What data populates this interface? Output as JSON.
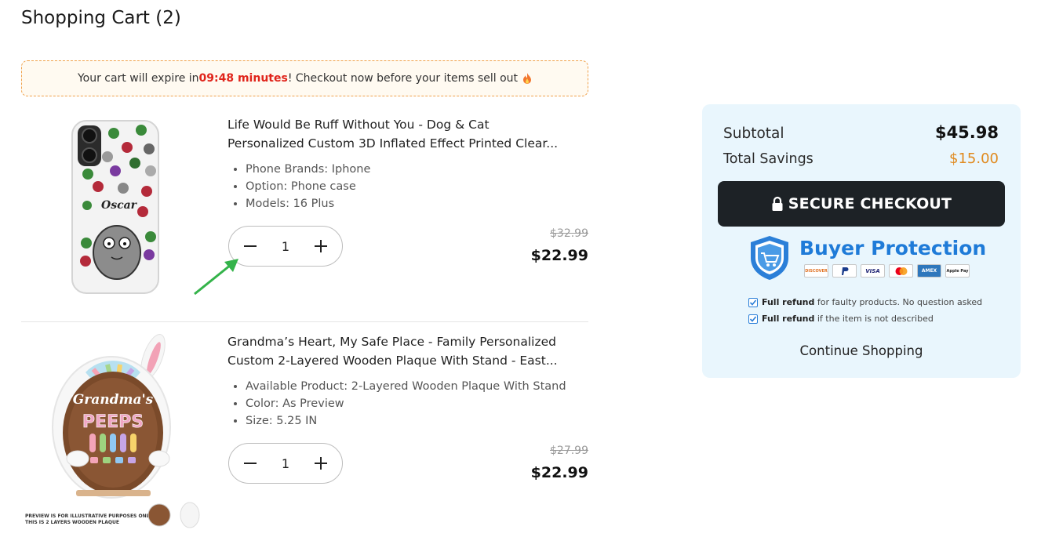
{
  "page": {
    "title": "Shopping Cart (2)"
  },
  "timer": {
    "prefix": "Your cart will expire in ",
    "time": "09:48 minutes",
    "suffix": "! Checkout now before your items sell out",
    "icon": "fire-icon"
  },
  "items": [
    {
      "title_line1": "Life Would Be Ruff Without You - Dog & Cat",
      "title_line2": "Personalized Custom 3D Inflated Effect Printed Clear...",
      "options": [
        "Phone Brands: Iphone",
        "Option: Phone case",
        "Models: 16 Plus"
      ],
      "quantity": "1",
      "old_price": "$32.99",
      "price": "$22.99",
      "image_text": "Oscar"
    },
    {
      "title_line1": "Grandma’s Heart, My Safe Place - Family Personalized",
      "title_line2": "Custom 2-Layered Wooden Plaque With Stand - East...",
      "options": [
        "Available Product: 2-Layered Wooden Plaque With Stand",
        "Color: As Preview",
        "Size: 5.25 IN"
      ],
      "quantity": "1",
      "old_price": "$27.99",
      "price": "$22.99",
      "image_text_1": "Grandma's",
      "image_text_2": "PEEPS",
      "image_caption_1": "PREVIEW IS FOR ILLUSTRATIVE PURPOSES ONLY",
      "image_caption_2": "THIS IS 2 LAYERS WOODEN PLAQUE"
    }
  ],
  "summary": {
    "subtotal_label": "Subtotal",
    "subtotal_value": "$45.98",
    "savings_label": "Total Savings",
    "savings_value": "$15.00",
    "checkout_label": "SECURE CHECKOUT",
    "protection_title": "Buyer Protection",
    "payment_methods": [
      "DISCOVER",
      "PayPal",
      "VISA",
      "Mastercard",
      "AMEX",
      "Apple Pay"
    ],
    "guarantee_1_bold": "Full refund",
    "guarantee_1_text": " for faulty products. No question asked",
    "guarantee_2_bold": "Full refund",
    "guarantee_2_text": " if the item is not described",
    "continue_label": "Continue Shopping"
  },
  "colors": {
    "accent_timer": "#e0241b",
    "savings": "#e08a1e",
    "checkout_bg": "#1d2226",
    "protection_blue": "#1f7bd8",
    "summary_bg": "#e9f6fd",
    "annotation_arrow": "#34b34a"
  }
}
